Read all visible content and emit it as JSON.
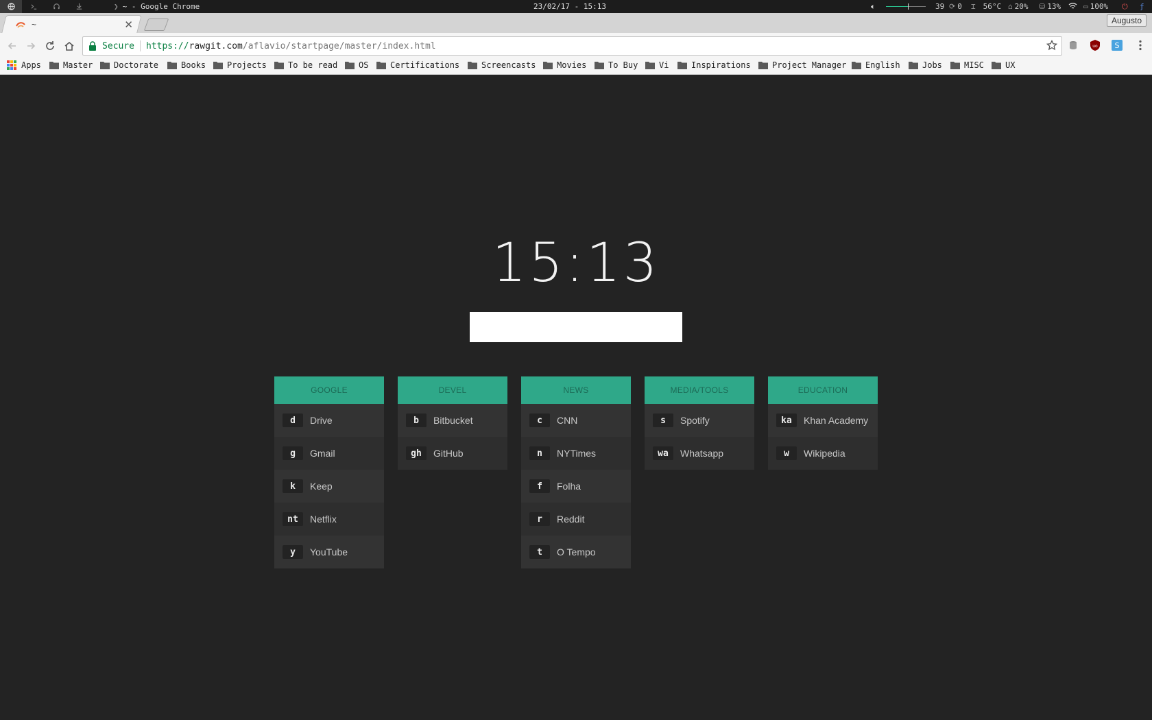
{
  "sysbar": {
    "window_title": "~ - Google Chrome",
    "chevron": "❯",
    "datetime": "23/02/17 - 15:13",
    "volume_percent": 56,
    "status": {
      "brightness": "39",
      "updates": "0",
      "temperature": "56°C",
      "cpu": "20%",
      "disk": "13%",
      "battery": "100%"
    },
    "icons": [
      "globe-icon",
      "terminal-icon",
      "headphones-icon",
      "download-icon",
      "speaker-icon",
      "refresh-icon",
      "thermometer-icon",
      "home-icon",
      "disk-icon",
      "wifi-icon",
      "battery-icon",
      "power-icon",
      "fedora-icon"
    ]
  },
  "browser": {
    "tab": {
      "title": "~",
      "close": "✕"
    },
    "profile": "Augusto",
    "omnibox": {
      "secure": "Secure",
      "scheme": "https://",
      "host": "rawgit.com",
      "path": "/aflavio/startpage/master/index.html"
    },
    "bookmarks": [
      {
        "label": "Apps",
        "type": "apps"
      },
      {
        "label": "Master",
        "type": "folder"
      },
      {
        "label": "Doctorate",
        "type": "folder"
      },
      {
        "label": "Books",
        "type": "folder"
      },
      {
        "label": "Projects",
        "type": "folder"
      },
      {
        "label": "To be read",
        "type": "folder"
      },
      {
        "label": "OS",
        "type": "folder"
      },
      {
        "label": "Certifications",
        "type": "folder"
      },
      {
        "label": "Screencasts",
        "type": "folder"
      },
      {
        "label": "Movies",
        "type": "folder"
      },
      {
        "label": "To Buy",
        "type": "folder"
      },
      {
        "label": "Vi",
        "type": "folder"
      },
      {
        "label": "Inspirations",
        "type": "folder"
      },
      {
        "label": "Project Manager",
        "type": "folder"
      },
      {
        "label": "English",
        "type": "folder"
      },
      {
        "label": "Jobs",
        "type": "folder"
      },
      {
        "label": "MISC",
        "type": "folder"
      },
      {
        "label": "UX",
        "type": "folder"
      }
    ]
  },
  "colors": {
    "page_bg": "#232323",
    "accent": "#2fa889",
    "header_text": "#1c6b56"
  },
  "startpage": {
    "clock": "15:13",
    "search": {
      "value": "",
      "placeholder": ""
    },
    "categories": [
      {
        "name": "GOOGLE",
        "links": [
          {
            "key": "d",
            "label": "Drive"
          },
          {
            "key": "g",
            "label": "Gmail"
          },
          {
            "key": "k",
            "label": "Keep"
          },
          {
            "key": "nt",
            "label": "Netflix"
          },
          {
            "key": "y",
            "label": "YouTube"
          }
        ]
      },
      {
        "name": "DEVEL",
        "links": [
          {
            "key": "b",
            "label": "Bitbucket"
          },
          {
            "key": "gh",
            "label": "GitHub"
          }
        ]
      },
      {
        "name": "NEWS",
        "links": [
          {
            "key": "c",
            "label": "CNN"
          },
          {
            "key": "n",
            "label": "NYTimes"
          },
          {
            "key": "f",
            "label": "Folha"
          },
          {
            "key": "r",
            "label": "Reddit"
          },
          {
            "key": "t",
            "label": "O Tempo"
          }
        ]
      },
      {
        "name": "MEDIA/TOOLS",
        "links": [
          {
            "key": "s",
            "label": "Spotify"
          },
          {
            "key": "wa",
            "label": "Whatsapp"
          }
        ]
      },
      {
        "name": "EDUCATION",
        "links": [
          {
            "key": "ka",
            "label": "Khan Academy"
          },
          {
            "key": "w",
            "label": "Wikipedia"
          }
        ]
      }
    ]
  }
}
